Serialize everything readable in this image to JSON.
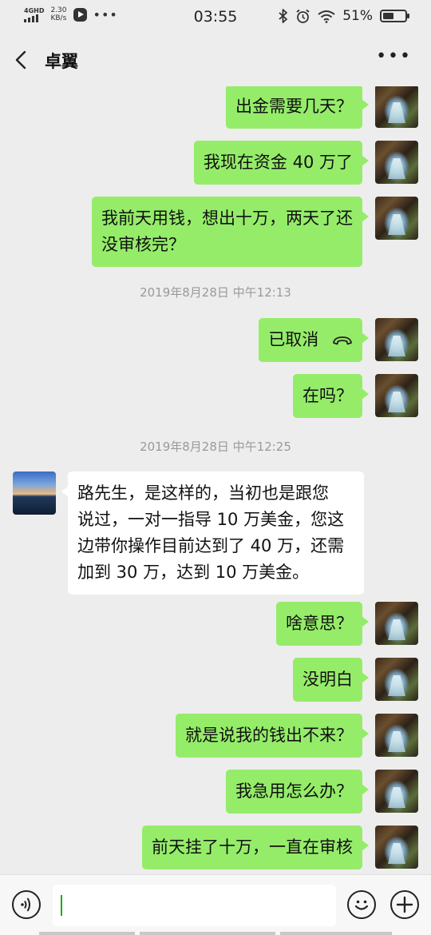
{
  "status_bar": {
    "network": "4GHD",
    "speed_value": "2.30",
    "speed_unit": "KB/s",
    "time": "03:55",
    "battery_percent": "51%",
    "battery_level": 0.51
  },
  "header": {
    "contact_name": "卓翼"
  },
  "messages": [
    {
      "sender": "me",
      "text": "出金需要几天？"
    },
    {
      "sender": "me",
      "text": "我现在资金 40 万了"
    },
    {
      "sender": "me",
      "lines": [
        "我前天用钱，想出十万，两天了还",
        "没审核完？"
      ]
    },
    {
      "sender": "system",
      "text": "2019年8月28日 中午12:13"
    },
    {
      "sender": "me",
      "text": "已取消",
      "icon": "hang-up-phone-icon"
    },
    {
      "sender": "me",
      "text": "在吗？"
    },
    {
      "sender": "system",
      "text": "2019年8月28日 中午12:25"
    },
    {
      "sender": "them",
      "lines": [
        "路先生，是这样的，当初也是跟您",
        "说过，一对一指导 10 万美金，您这",
        "边带你操作目前达到了 40 万，还需",
        "加到 30 万，达到 10 万美金。"
      ]
    },
    {
      "sender": "me",
      "text": "啥意思？"
    },
    {
      "sender": "me",
      "text": "没明白"
    },
    {
      "sender": "me",
      "text": "就是说我的钱出不来？"
    },
    {
      "sender": "me",
      "text": "我急用怎么办？"
    },
    {
      "sender": "me",
      "text": "前天挂了十万，一直在审核"
    }
  ],
  "input": {
    "value": ""
  },
  "icons": {
    "back": "chevron-left-icon",
    "more": "more-dots-icon",
    "voice": "voice-mode-icon",
    "emoji": "emoji-icon",
    "plus": "plus-icon"
  }
}
